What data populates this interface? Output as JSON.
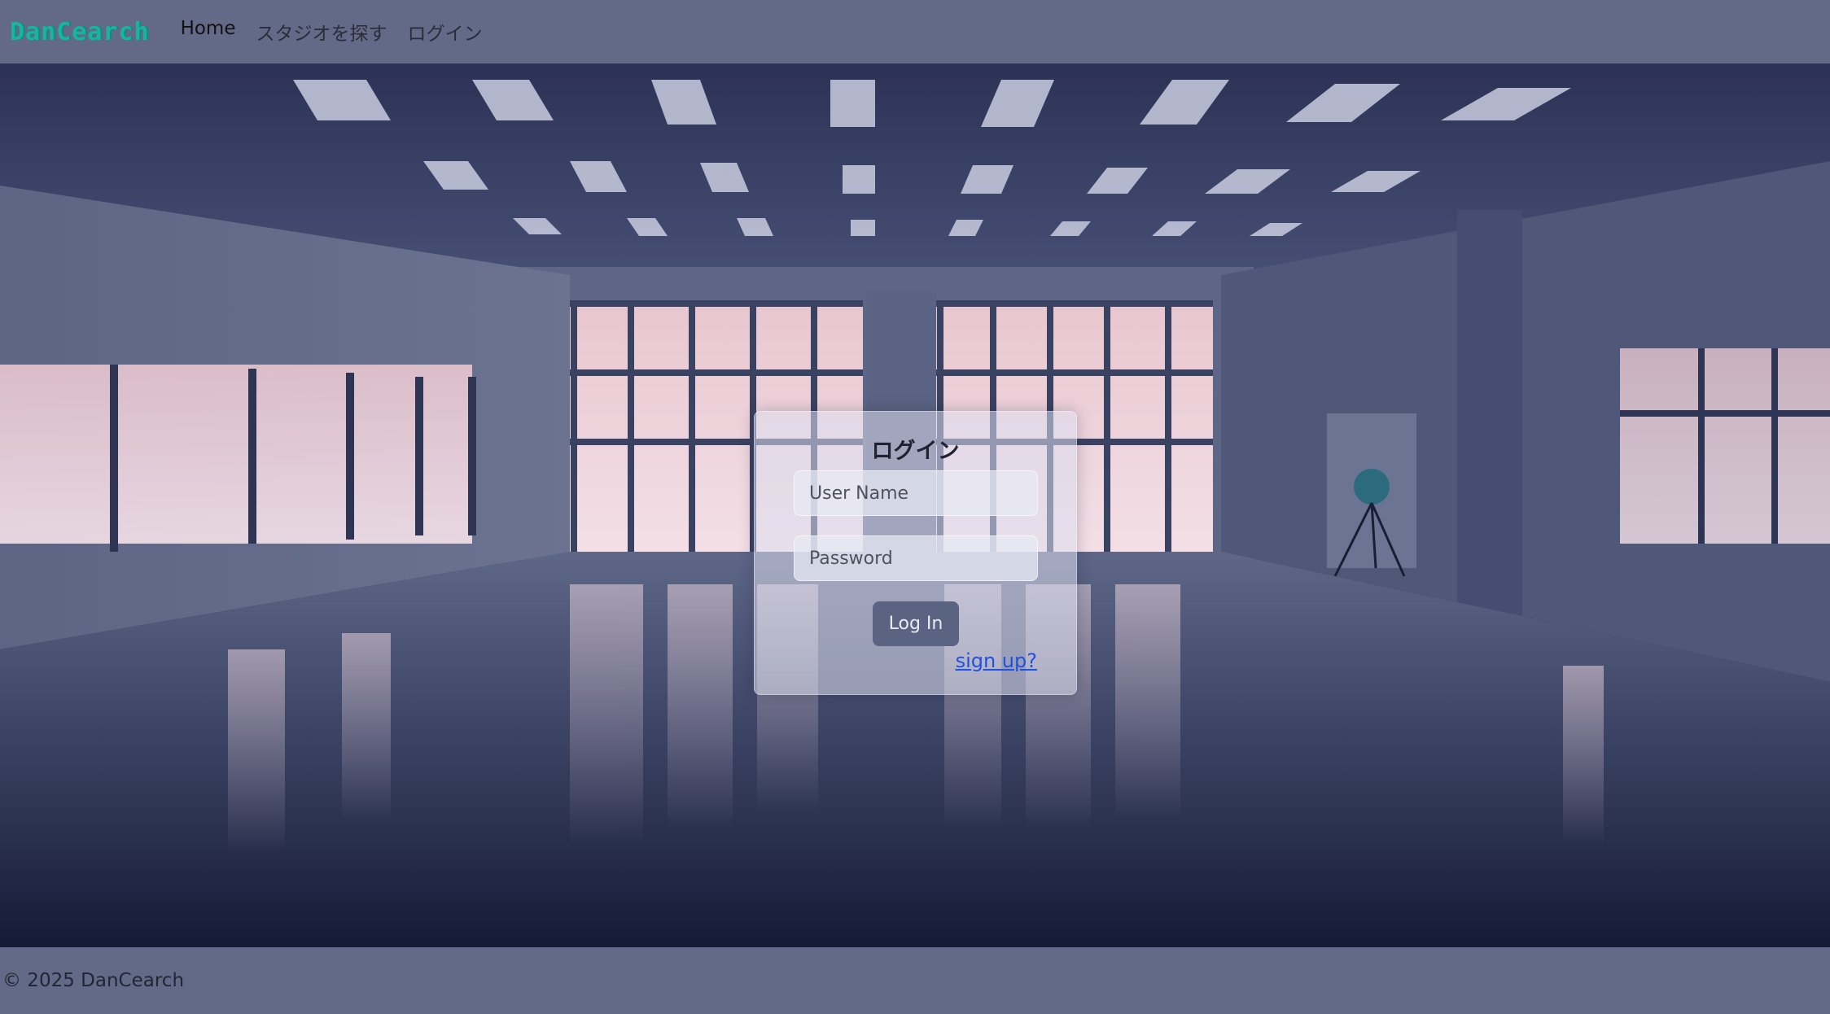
{
  "navbar": {
    "brand": "DanCearch",
    "links": [
      {
        "label": "Home",
        "active": true
      },
      {
        "label": "スタジオを探す",
        "active": false
      },
      {
        "label": "ログイン",
        "active": false
      }
    ]
  },
  "login": {
    "title": "ログイン",
    "username_placeholder": "User Name",
    "password_placeholder": "Password",
    "submit_label": "Log In",
    "signup_link": "sign up?"
  },
  "footer": {
    "copyright": "© 2025 DanCearch"
  },
  "colors": {
    "navbar_bg": "#636a88",
    "brand": "#19b3a0",
    "button_bg": "#5b6383",
    "link": "#1f52e0"
  }
}
